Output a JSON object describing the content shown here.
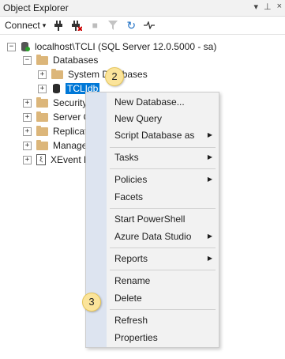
{
  "panel": {
    "title": "Object Explorer",
    "controls": [
      "▾",
      "⊥",
      "×"
    ]
  },
  "toolbar": {
    "connect_label": "Connect",
    "icons": [
      "connect-icon",
      "disconnect-icon",
      "stop-icon",
      "filter-icon",
      "refresh-icon",
      "activity-monitor-icon"
    ]
  },
  "tree": {
    "server": "localhost\\TCLI (SQL Server 12.0.5000 - sa)",
    "databases": "Databases",
    "system_databases": "System Databases",
    "selected_db": "TCLIdb",
    "security": "Security",
    "server_objects": "Server O",
    "replication": "Replicati",
    "management": "Manage",
    "xevent": "XEvent P"
  },
  "badges": {
    "badge_2": "2",
    "badge_3": "3"
  },
  "context_menu": {
    "new_database": "New Database...",
    "new_query": "New Query",
    "script_database_as": "Script Database as",
    "tasks": "Tasks",
    "policies": "Policies",
    "facets": "Facets",
    "start_powershell": "Start PowerShell",
    "azure_data_studio": "Azure Data Studio",
    "reports": "Reports",
    "rename": "Rename",
    "delete": "Delete",
    "refresh": "Refresh",
    "properties": "Properties"
  },
  "colors": {
    "selection": "#0078d7",
    "badge": "#fbe49a",
    "menu_gutter": "#dde4f0"
  }
}
